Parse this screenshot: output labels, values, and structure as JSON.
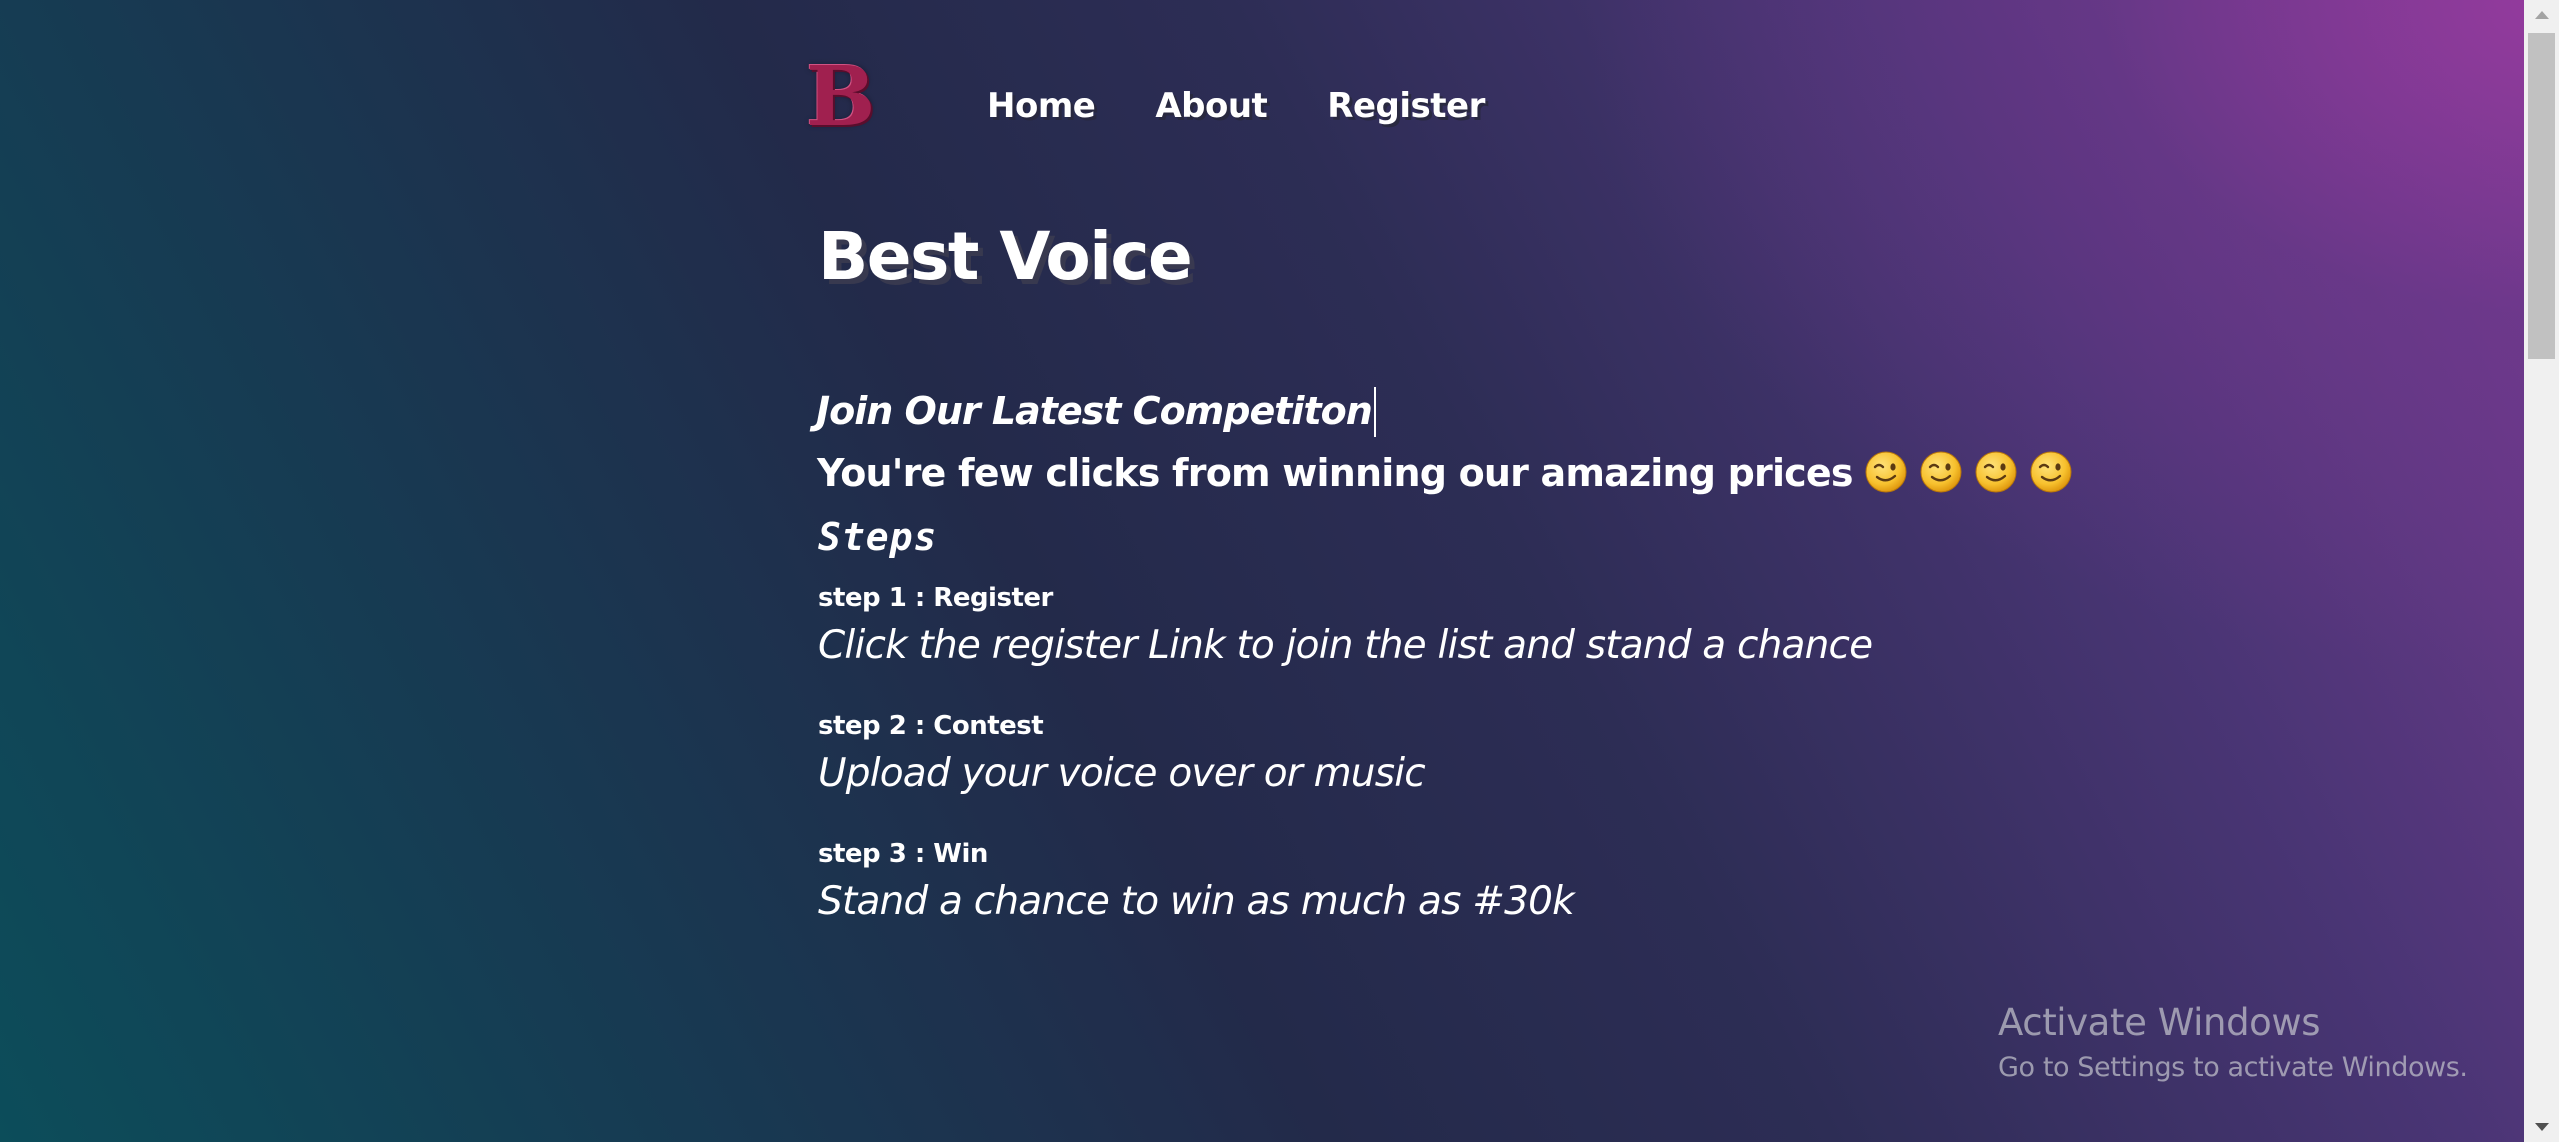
{
  "header": {
    "logo_text": "B",
    "nav": [
      {
        "label": "Home"
      },
      {
        "label": "About"
      },
      {
        "label": "Register"
      }
    ]
  },
  "main": {
    "title": "Best Voice",
    "subtitle": "Join Our Latest Competiton",
    "tagline": "You're few clicks from winning our amazing prices",
    "emoji_icon": "winking-face-icon",
    "emoji_count": 4,
    "steps_heading": "Steps",
    "steps": [
      {
        "label": "step 1 : Register",
        "text": "Click the register Link to join the list and stand a chance"
      },
      {
        "label": "step 2 : Contest",
        "text": "Upload your voice over or music"
      },
      {
        "label": "step 3 : Win",
        "text": "Stand a chance to win as much as #30k"
      }
    ]
  },
  "watermark": {
    "title": "Activate Windows",
    "subtitle": "Go to Settings to activate Windows."
  },
  "colors": {
    "logo": "#a0204f",
    "text": "#ffffff",
    "background_start": "#0c4d5a",
    "background_mid": "#232a4a",
    "background_end": "#7a3c93"
  }
}
